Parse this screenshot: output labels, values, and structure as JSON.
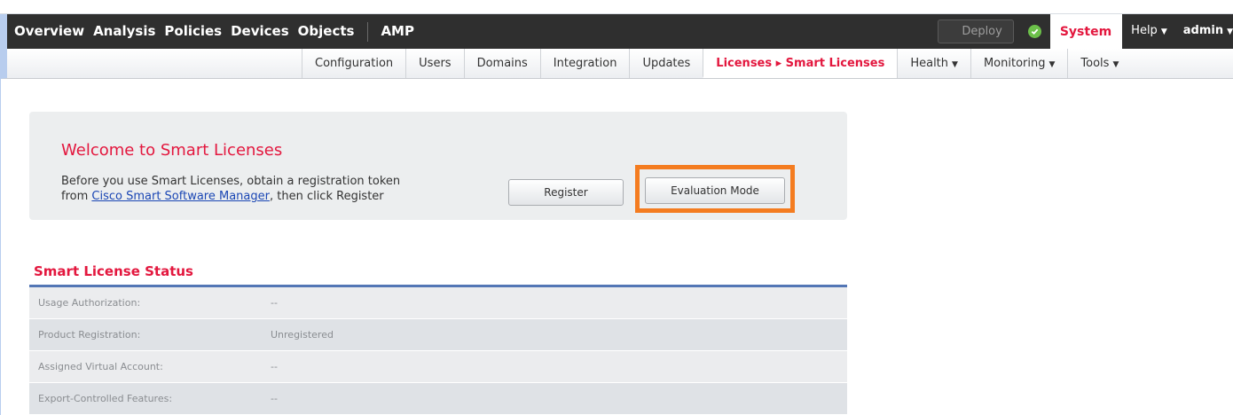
{
  "top_nav": {
    "items": [
      "Overview",
      "Analysis",
      "Policies",
      "Devices",
      "Objects",
      "AMP"
    ],
    "deploy_label": "Deploy",
    "status_icon": "check-circle-icon",
    "system_label": "System",
    "help_label": "Help",
    "admin_label": "admin"
  },
  "sub_nav": {
    "items": [
      "Configuration",
      "Users",
      "Domains",
      "Integration",
      "Updates",
      "Licenses ▸ Smart Licenses",
      "Health",
      "Monitoring",
      "Tools"
    ],
    "active_index": 5
  },
  "welcome": {
    "title": "Welcome to Smart Licenses",
    "line1": "Before you use Smart Licenses, obtain a registration token",
    "line2_prefix": "from ",
    "link_text": "Cisco Smart Software Manager",
    "line2_suffix": ", then click Register",
    "register_label": "Register",
    "evaluation_label": "Evaluation Mode"
  },
  "status": {
    "title": "Smart License Status",
    "rows": [
      {
        "label": "Usage Authorization:",
        "value": "--"
      },
      {
        "label": "Product Registration:",
        "value": "Unregistered"
      },
      {
        "label": "Assigned Virtual Account:",
        "value": "--"
      },
      {
        "label": "Export-Controlled Features:",
        "value": "--"
      }
    ]
  },
  "colors": {
    "accent_red": "#e3173e",
    "highlight_orange": "#f47c20",
    "topbar_dark": "#2f2f2f",
    "rule_blue": "#5376b5",
    "status_green": "#6cc04a"
  }
}
